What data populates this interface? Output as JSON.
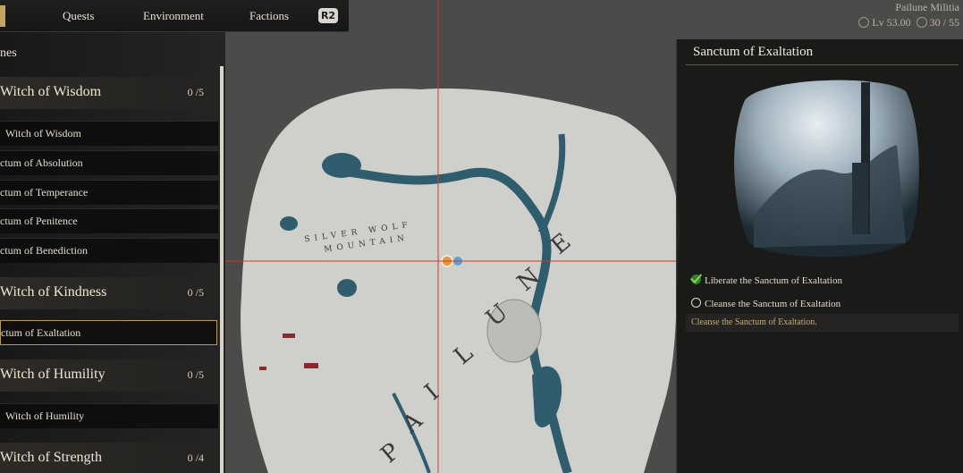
{
  "topbar": {
    "tabs": [
      "Quests",
      "Environment",
      "Factions"
    ],
    "button": "R2"
  },
  "status": {
    "faction": "Pailune Militia",
    "level": "Lv 53.00",
    "counter": "30 / 55"
  },
  "left_panel": {
    "header": "nes",
    "groups": [
      {
        "title": "Witch of Wisdom",
        "count": "0 /5",
        "items": [
          "Witch of Wisdom",
          "ctum of Absolution",
          "ctum of Temperance",
          "ctum of Penitence",
          "ctum of Benediction"
        ]
      },
      {
        "title": "Witch of Kindness",
        "count": "0 /5",
        "items": [
          "ctum of Exaltation"
        ]
      },
      {
        "title": "Witch of Humility",
        "count": "0 /5",
        "items": [
          "Witch of Humility"
        ]
      },
      {
        "title": "Witch of Strength",
        "count": "0 /4",
        "items": []
      }
    ]
  },
  "quest_panel": {
    "title": "Sanctum of Exaltation",
    "objectives": [
      {
        "label": "Liberate the Sanctum of Exaltation",
        "done": true
      },
      {
        "label": "Cleanse the Sanctum of Exaltation",
        "done": false
      }
    ],
    "description": "Cleanse the Sanctum of Exaltation."
  },
  "map": {
    "region_letters": [
      "P",
      "A",
      "I",
      "L",
      "U",
      "N",
      "E"
    ],
    "mountain_line1": "SILVER WOLF",
    "mountain_line2": "MOUNTAIN",
    "colors": {
      "land": "#cfcfcb",
      "water": "#2f5d6e",
      "crosshair": "#d23a2f",
      "outside": "#4a4a48"
    }
  }
}
